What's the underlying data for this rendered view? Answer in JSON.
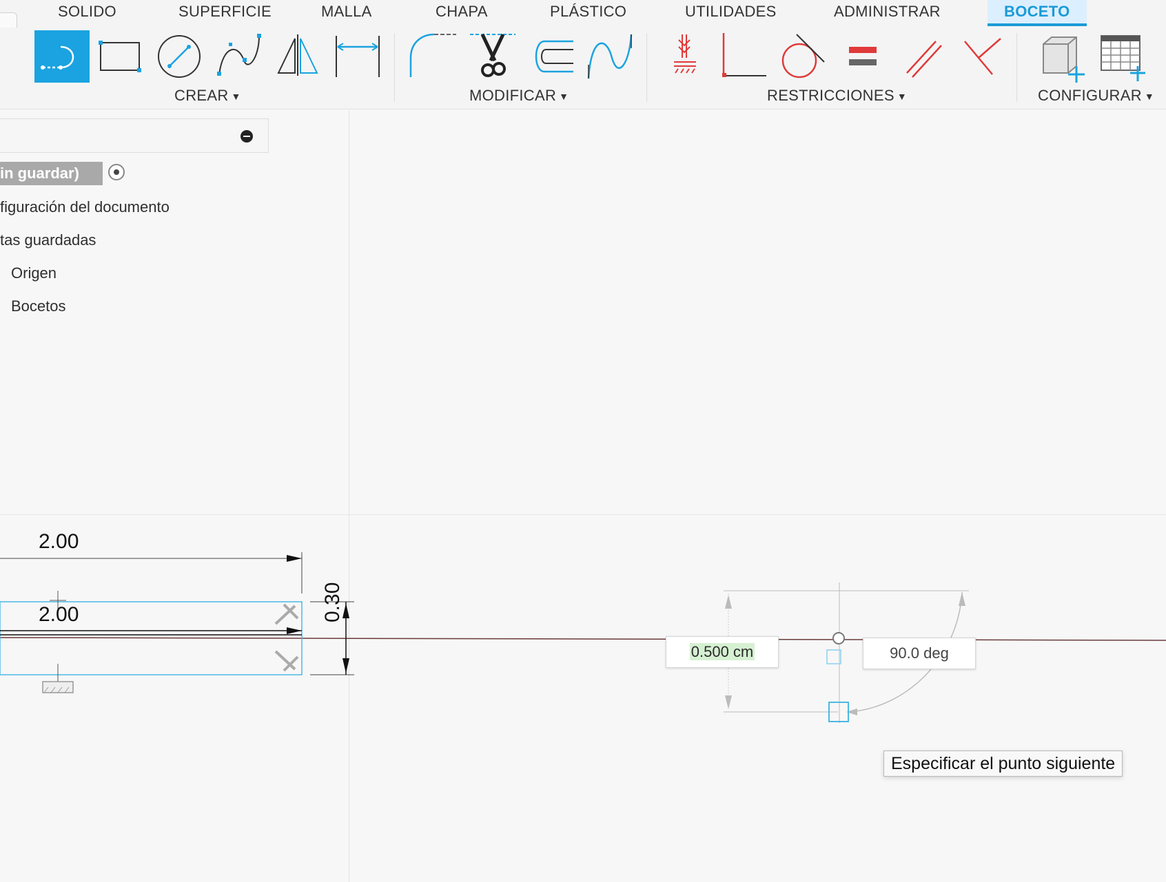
{
  "tabs": [
    {
      "label": "SOLIDO"
    },
    {
      "label": "SUPERFICIE"
    },
    {
      "label": "MALLA"
    },
    {
      "label": "CHAPA"
    },
    {
      "label": "PLÁSTICO"
    },
    {
      "label": "UTILIDADES"
    },
    {
      "label": "ADMINISTRAR"
    },
    {
      "label": "BOCETO",
      "active": true
    }
  ],
  "toolbar_groups": {
    "crear": "CREAR",
    "modificar": "MODIFICAR",
    "restricciones": "RESTRICCIONES",
    "configurar": "CONFIGURAR"
  },
  "colors": {
    "accent": "#1a9bd7",
    "active_tool_bg": "#1aa3e0",
    "constraint_red": "#e03a3a",
    "sketch_blue": "#1aa3e0",
    "length_highlight": "#d6f0d2"
  },
  "icons": {
    "crear": [
      "line-icon",
      "rectangle-icon",
      "circle-icon",
      "spline-icon",
      "mirror-icon",
      "dimension-icon"
    ],
    "modificar": [
      "fillet-icon",
      "trim-icon",
      "offset-icon",
      "spline-curvature-icon"
    ],
    "restricciones": [
      "fix-icon",
      "perpendicular-icon",
      "tangent-icon",
      "equal-icon",
      "parallel-icon",
      "perpendicular-x-icon"
    ],
    "configurar": [
      "component-config-icon",
      "table-config-icon"
    ]
  },
  "browser": {
    "doc_name": "in guardar)",
    "items": [
      {
        "label": "figuración del documento"
      },
      {
        "label": "tas guardadas"
      },
      {
        "label": "Origen"
      },
      {
        "label": "Bocetos"
      }
    ]
  },
  "canvas": {
    "dim_top": "2.00",
    "dim_mid": "2.00",
    "dim_vert": "0.30",
    "length_input": "0.500 cm",
    "angle_input": "90.0 deg",
    "tooltip": "Especificar el punto siguiente"
  }
}
